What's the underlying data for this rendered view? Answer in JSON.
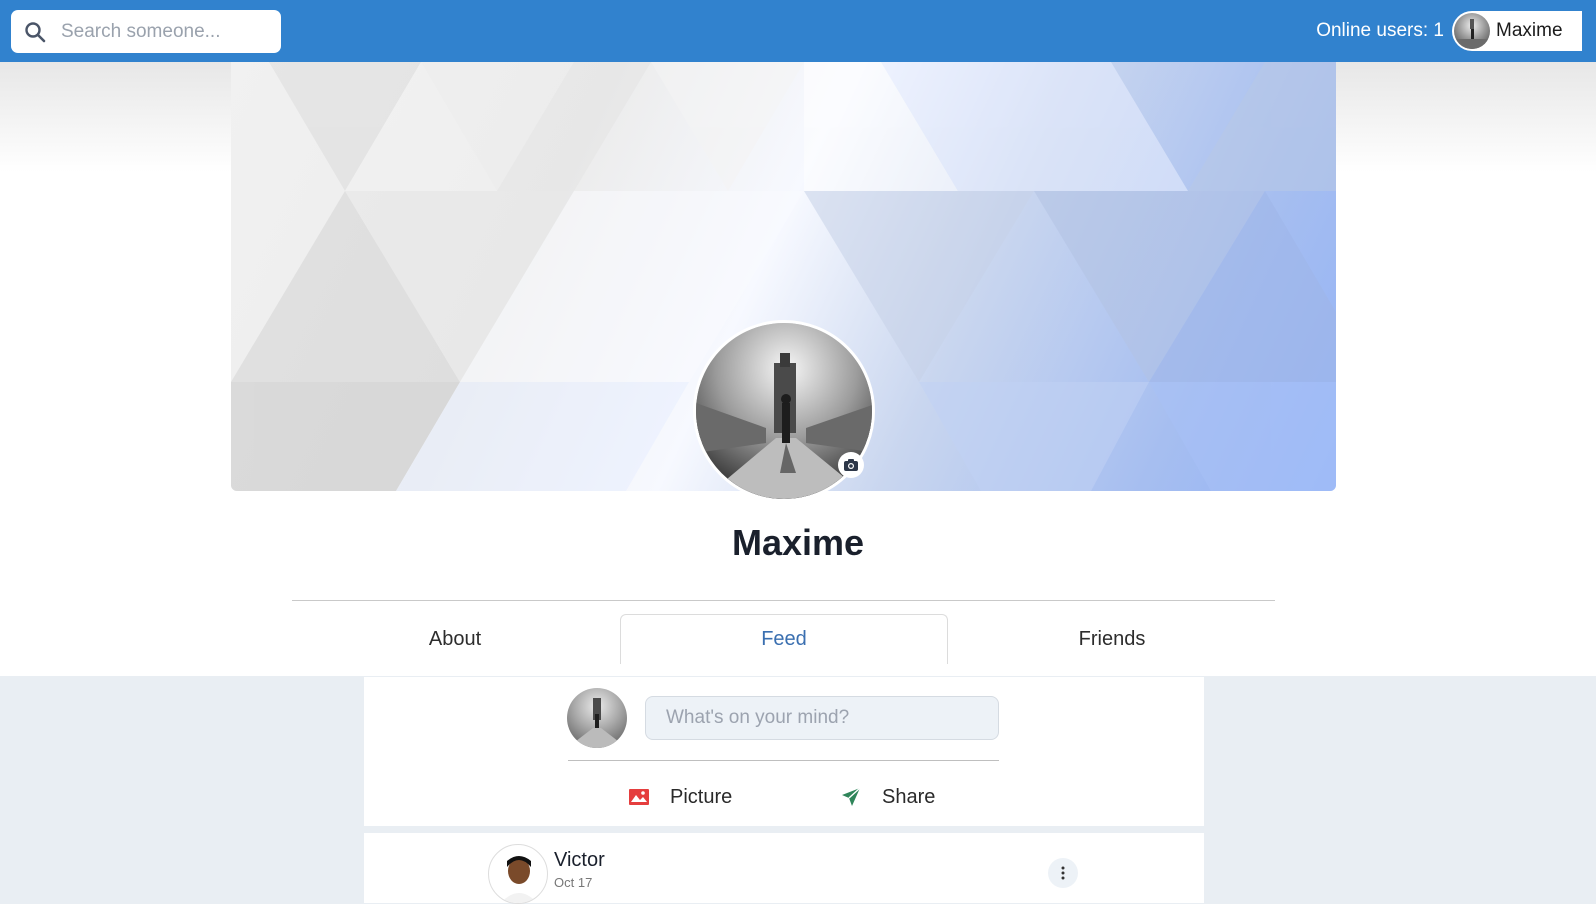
{
  "topbar": {
    "search_placeholder": "Search someone...",
    "online_label": "Online users: 1",
    "user_name": "Maxime"
  },
  "profile": {
    "name": "Maxime"
  },
  "tabs": [
    {
      "label": "About",
      "active": false
    },
    {
      "label": "Feed",
      "active": true
    },
    {
      "label": "Friends",
      "active": false
    }
  ],
  "composer": {
    "placeholder": "What's on your mind?",
    "picture_label": "Picture",
    "share_label": "Share"
  },
  "post": {
    "author": "Victor",
    "date": "Oct 17"
  },
  "colors": {
    "topbar": "#3182ce",
    "picture_icon": "#e53e3e",
    "share_icon": "#2f855a"
  },
  "icons": {
    "search": "search-icon",
    "camera": "camera-icon",
    "picture": "image-icon",
    "share": "send-icon",
    "more": "more-vertical-icon"
  }
}
